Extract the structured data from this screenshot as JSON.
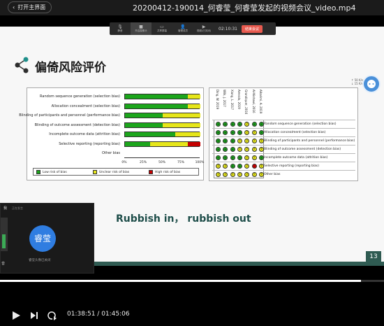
{
  "window": {
    "back_label": "打开主界面",
    "video_title": "20200412-190014_何睿莹_何睿莹发起的视频会议_video.mp4"
  },
  "meeting_bar": {
    "items": [
      {
        "label": "静音",
        "icon": "mic-icon",
        "glyph": "🎙"
      },
      {
        "label": "开启摄像头",
        "icon": "camera-icon",
        "glyph": "■"
      },
      {
        "label": "共享屏幕",
        "icon": "share-screen-icon",
        "glyph": "▭"
      },
      {
        "label": "管理成员",
        "icon": "members-icon",
        "glyph": "👤"
      },
      {
        "label": "视频(已关闭)",
        "icon": "video-icon",
        "glyph": "▶"
      }
    ],
    "time": "02:10:31",
    "end_label": "结束会议"
  },
  "slide": {
    "title": "偏倚风险评价",
    "quote": "Rubbish in， rubbish out",
    "page_number": "13"
  },
  "chart_data": [
    {
      "type": "bar",
      "orientation": "horizontal-stacked",
      "categories": [
        "Random sequence generation (selection bias)",
        "Allocation concealment (selection bias)",
        "Blinding of participants and personnel (performance bias)",
        "Blinding of outcome assessment (detection bias)",
        "Incomplete outcome data (attrition bias)",
        "Selective reporting (reporting bias)",
        "Other bias"
      ],
      "series": [
        {
          "name": "Low risk of bias",
          "color": "#1ca61c",
          "values": [
            83,
            83,
            50,
            50,
            67,
            33,
            0
          ]
        },
        {
          "name": "Unclear risk of bias",
          "color": "#e6e61a",
          "values": [
            17,
            17,
            50,
            50,
            33,
            50,
            0
          ]
        },
        {
          "name": "High risk of bias",
          "color": "#c40000",
          "values": [
            0,
            0,
            0,
            0,
            0,
            17,
            0
          ]
        }
      ],
      "xticks": [
        "0%",
        "25%",
        "50%",
        "75%",
        "100%"
      ],
      "xlim": [
        0,
        100
      ]
    },
    {
      "type": "table",
      "columns": [
        "Ding, W. 2019",
        "Wilk, J. 2017",
        "Xiong, L. 2017",
        "Arevalo, 2019",
        "Grandiquer, 2016",
        "Al-Nishawi, 2016",
        "Alkarimi, A. 2019"
      ],
      "rows": [
        "Random sequence generation (selection bias)",
        "Allocation concealment (selection bias)",
        "Blinding of participants and personnel (performance bias)",
        "Blinding of outcome assessment (detection bias)",
        "Incomplete outcome data (attrition bias)",
        "Selective reporting (reporting bias)",
        "Other bias"
      ],
      "cells": [
        [
          "+",
          "+",
          "+",
          "+",
          "?",
          "+",
          "+"
        ],
        [
          "+",
          "+",
          "+",
          "+",
          "?",
          "?",
          "+"
        ],
        [
          "+",
          "+",
          "+",
          "?",
          "?",
          "?",
          "?"
        ],
        [
          "+",
          "+",
          "+",
          "?",
          "?",
          "?",
          "?"
        ],
        [
          "+",
          "+",
          "+",
          "+",
          "?",
          "?",
          "+"
        ],
        [
          "?",
          "?",
          "+",
          "+",
          "?",
          "-",
          "?"
        ],
        [
          "?",
          "?",
          "?",
          "?",
          "?",
          "?",
          "?"
        ]
      ],
      "colors": {
        "+": "#1ca61c",
        "?": "#e6e61a",
        "-": "#c40000"
      }
    }
  ],
  "side_widget": {
    "up": "↑ 50 K/s",
    "down": "↓ 15 K/s"
  },
  "participant_panel": {
    "header": "我",
    "subheader": "正在发言",
    "avatar_text": "睿莹",
    "caption": "睿莹头像已关闭",
    "left_text": "音"
  },
  "player": {
    "current_time": "01:38:51",
    "total_time": "01:45:06",
    "progress_fraction": 0.94
  }
}
